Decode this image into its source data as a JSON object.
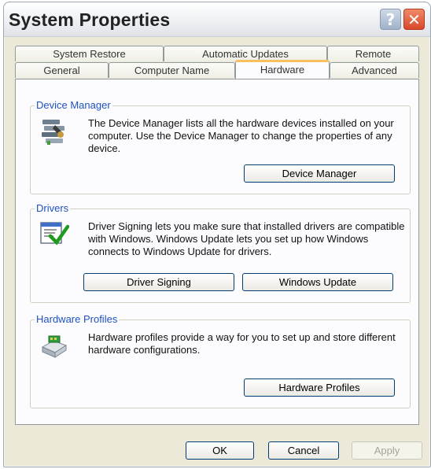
{
  "window": {
    "title": "System Properties"
  },
  "title_buttons": {
    "help": "?",
    "close": "✕"
  },
  "tabs_back": [
    "System Restore",
    "Automatic Updates",
    "Remote"
  ],
  "tabs_front": [
    "General",
    "Computer Name",
    "Hardware",
    "Advanced"
  ],
  "active_tab": "Hardware",
  "device_manager": {
    "legend": "Device Manager",
    "text": "The Device Manager lists all the hardware devices installed on your computer. Use the Device Manager to change the properties of any device.",
    "button": "Device Manager"
  },
  "drivers": {
    "legend": "Drivers",
    "text": "Driver Signing lets you make sure that installed drivers are compatible with Windows. Windows Update lets you set up how Windows connects to Windows Update for drivers.",
    "button_signing": "Driver Signing",
    "button_update": "Windows Update"
  },
  "hardware_profiles": {
    "legend": "Hardware Profiles",
    "text": "Hardware profiles provide a way for you to set up and store different hardware configurations.",
    "button": "Hardware Profiles"
  },
  "footer": {
    "ok": "OK",
    "cancel": "Cancel",
    "apply": "Apply"
  }
}
